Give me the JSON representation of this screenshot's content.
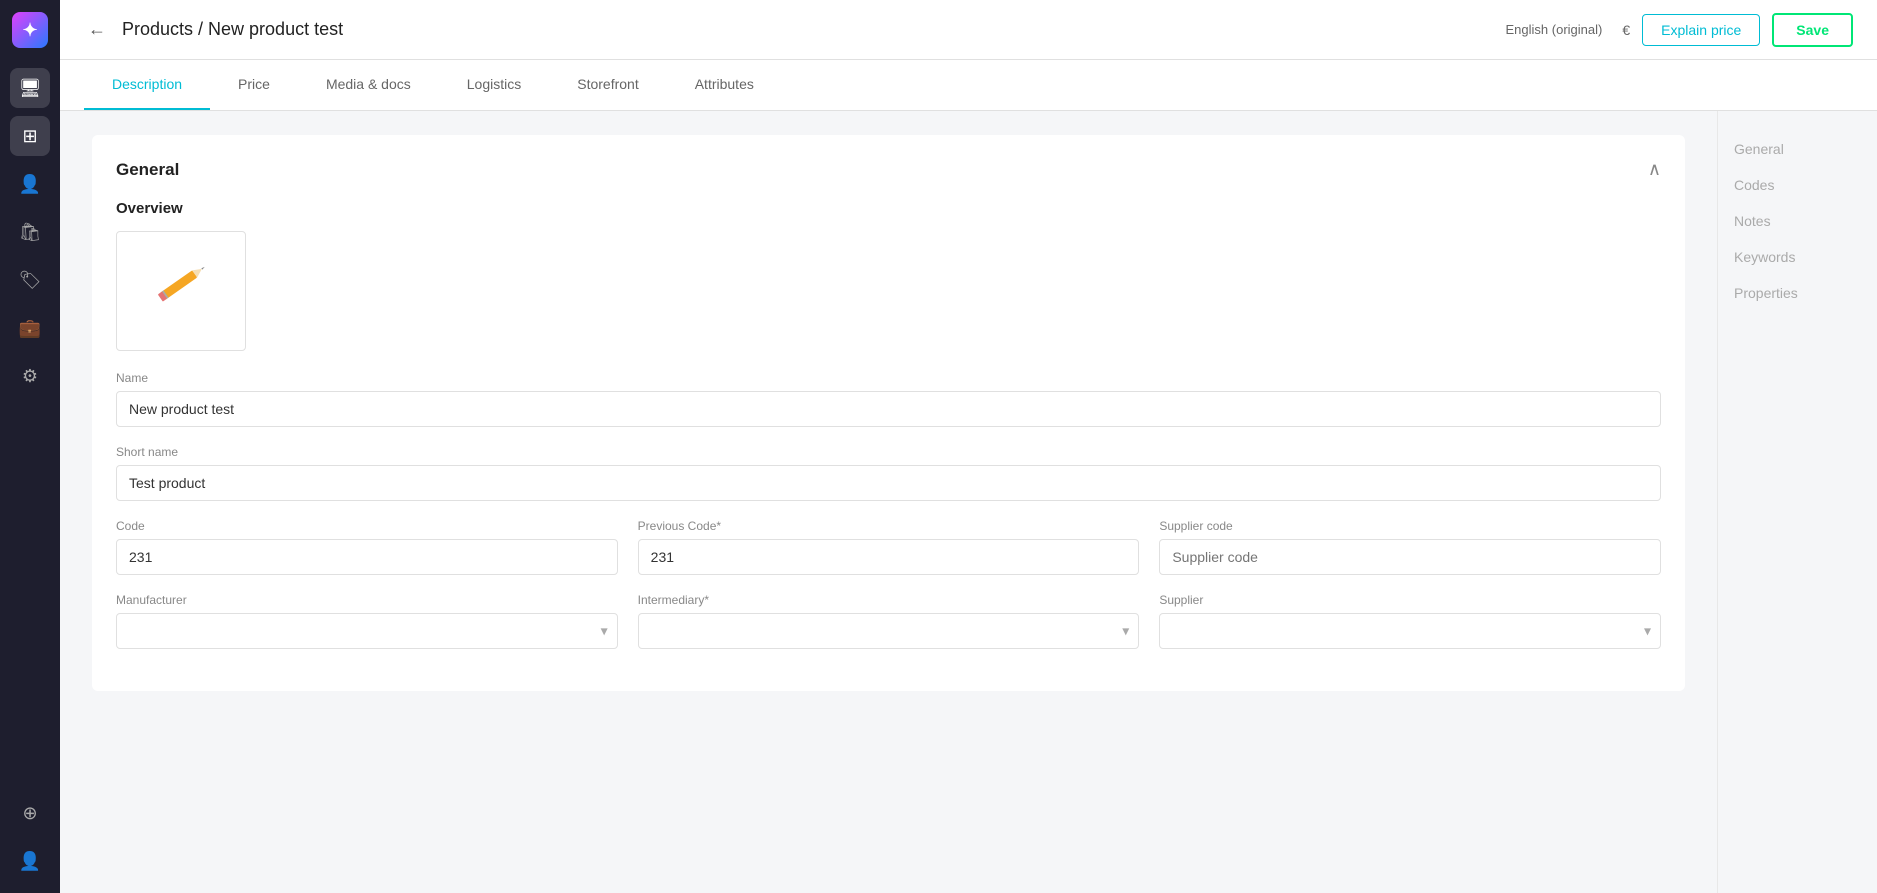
{
  "app": {
    "logo_symbol": "✦"
  },
  "topbar": {
    "back_icon": "←",
    "breadcrumb": "Products / New product test",
    "language": "English (original)",
    "currency": "€",
    "explain_btn": "Explain price",
    "save_btn": "Save"
  },
  "tabs": [
    {
      "id": "description",
      "label": "Description",
      "active": true
    },
    {
      "id": "price",
      "label": "Price",
      "active": false
    },
    {
      "id": "media",
      "label": "Media & docs",
      "active": false
    },
    {
      "id": "logistics",
      "label": "Logistics",
      "active": false
    },
    {
      "id": "storefront",
      "label": "Storefront",
      "active": false
    },
    {
      "id": "attributes",
      "label": "Attributes",
      "active": false
    }
  ],
  "section": {
    "title": "General",
    "collapse_icon": "⌃"
  },
  "overview": {
    "title": "Overview"
  },
  "fields": {
    "name_label": "Name",
    "name_value": "New product test",
    "short_name_label": "Short name",
    "short_name_value": "Test product",
    "code_label": "Code",
    "code_value": "231",
    "prev_code_label": "Previous Code*",
    "prev_code_value": "231",
    "supplier_code_label": "Supplier code",
    "supplier_code_placeholder": "Supplier code",
    "manufacturer_label": "Manufacturer",
    "intermediary_label": "Intermediary*",
    "supplier_label": "Supplier"
  },
  "right_sidebar": {
    "items": [
      {
        "id": "general",
        "label": "General",
        "active": false
      },
      {
        "id": "codes",
        "label": "Codes",
        "active": false
      },
      {
        "id": "notes",
        "label": "Notes",
        "active": false
      },
      {
        "id": "keywords",
        "label": "Keywords",
        "active": false
      },
      {
        "id": "properties",
        "label": "Properties",
        "active": false
      }
    ]
  },
  "sidebar_icons": [
    {
      "id": "home",
      "icon": "⊞",
      "active": true
    },
    {
      "id": "users",
      "icon": "👤",
      "active": false
    },
    {
      "id": "shopping",
      "icon": "🛍",
      "active": false
    },
    {
      "id": "tags",
      "icon": "🏷",
      "active": false
    },
    {
      "id": "briefcase",
      "icon": "💼",
      "active": false
    },
    {
      "id": "settings",
      "icon": "⚙",
      "active": false
    },
    {
      "id": "monitor",
      "icon": "🖥",
      "active": false
    },
    {
      "id": "add",
      "icon": "⊕",
      "active": false
    },
    {
      "id": "profile",
      "icon": "👤",
      "active": false
    }
  ]
}
